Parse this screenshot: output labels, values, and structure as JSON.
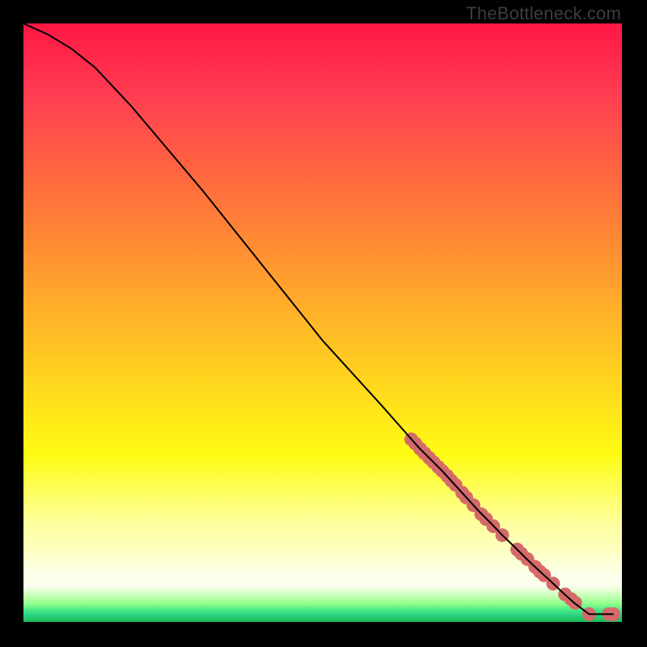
{
  "watermark": "TheBottleneck.com",
  "chart_data": {
    "type": "line",
    "title": "",
    "xlabel": "",
    "ylabel": "",
    "xlim": [
      0,
      100
    ],
    "ylim": [
      0,
      100
    ],
    "grid": false,
    "legend": false,
    "series": [
      {
        "name": "curve",
        "style": "line",
        "color": "#000000",
        "points": [
          {
            "x": 0,
            "y": 100
          },
          {
            "x": 4,
            "y": 98.2
          },
          {
            "x": 8,
            "y": 95.8
          },
          {
            "x": 12,
            "y": 92.6
          },
          {
            "x": 18,
            "y": 86.2
          },
          {
            "x": 30,
            "y": 72
          },
          {
            "x": 40,
            "y": 59.5
          },
          {
            "x": 50,
            "y": 47
          },
          {
            "x": 60,
            "y": 36
          },
          {
            "x": 66,
            "y": 29.2
          },
          {
            "x": 70,
            "y": 25.2
          },
          {
            "x": 72,
            "y": 23
          },
          {
            "x": 74,
            "y": 20.8
          },
          {
            "x": 76,
            "y": 18.6
          },
          {
            "x": 78,
            "y": 16.6
          },
          {
            "x": 80,
            "y": 14.5
          },
          {
            "x": 82,
            "y": 12.6
          },
          {
            "x": 84,
            "y": 10.6
          },
          {
            "x": 86,
            "y": 8.7
          },
          {
            "x": 88,
            "y": 6.9
          },
          {
            "x": 90,
            "y": 5.0
          },
          {
            "x": 92,
            "y": 3.2
          },
          {
            "x": 94.5,
            "y": 1.3
          },
          {
            "x": 97,
            "y": 1.3
          },
          {
            "x": 98.5,
            "y": 1.3
          }
        ]
      },
      {
        "name": "markers",
        "style": "scatter",
        "color": "#d46a6a",
        "points": [
          {
            "x": 64.8,
            "y": 30.5
          },
          {
            "x": 65.5,
            "y": 29.8
          },
          {
            "x": 66.3,
            "y": 28.9
          },
          {
            "x": 67.0,
            "y": 28.2
          },
          {
            "x": 67.8,
            "y": 27.4
          },
          {
            "x": 68.5,
            "y": 26.7
          },
          {
            "x": 69.3,
            "y": 25.9
          },
          {
            "x": 70.0,
            "y": 25.2
          },
          {
            "x": 70.8,
            "y": 24.4
          },
          {
            "x": 71.5,
            "y": 23.6
          },
          {
            "x": 72.2,
            "y": 22.9
          },
          {
            "x": 73.3,
            "y": 21.6
          },
          {
            "x": 74.0,
            "y": 20.8
          },
          {
            "x": 75.2,
            "y": 19.5
          },
          {
            "x": 76.5,
            "y": 18.0
          },
          {
            "x": 77.3,
            "y": 17.2
          },
          {
            "x": 78.5,
            "y": 16.0
          },
          {
            "x": 80.0,
            "y": 14.5
          },
          {
            "x": 82.5,
            "y": 12.1
          },
          {
            "x": 83.2,
            "y": 11.4
          },
          {
            "x": 84.2,
            "y": 10.5
          },
          {
            "x": 85.5,
            "y": 9.2
          },
          {
            "x": 86.3,
            "y": 8.4
          },
          {
            "x": 87.0,
            "y": 7.8
          },
          {
            "x": 88.5,
            "y": 6.4
          },
          {
            "x": 90.5,
            "y": 4.6
          },
          {
            "x": 91.5,
            "y": 3.8
          },
          {
            "x": 92.2,
            "y": 3.2
          },
          {
            "x": 94.5,
            "y": 1.3
          },
          {
            "x": 97.8,
            "y": 1.3
          },
          {
            "x": 98.6,
            "y": 1.3
          }
        ]
      }
    ]
  }
}
